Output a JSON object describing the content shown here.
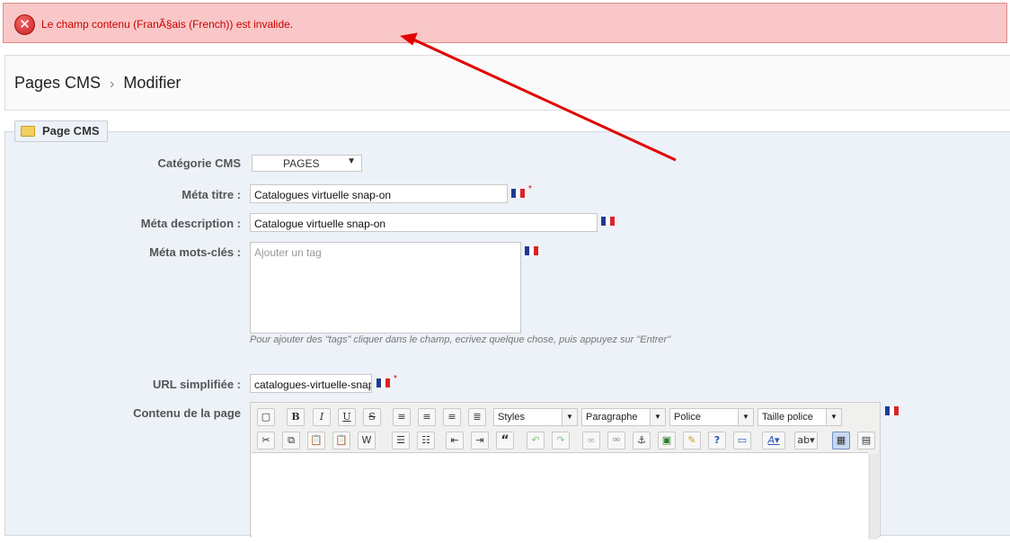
{
  "error": {
    "message": "Le champ contenu (FranÃ§ais (French)) est invalide."
  },
  "breadcrumb": {
    "parent": "Pages CMS",
    "current": "Modifier"
  },
  "panel": {
    "legend": "Page CMS"
  },
  "form": {
    "category": {
      "label": "Catégorie CMS",
      "value": "PAGES"
    },
    "meta_title": {
      "label": "Méta titre :",
      "value": "Catalogues virtuelle snap-on"
    },
    "meta_description": {
      "label": "Méta description :",
      "value": "Catalogue virtuelle snap-on"
    },
    "meta_keywords": {
      "label": "Méta mots-clés :",
      "placeholder": "Ajouter un tag",
      "help": "Pour ajouter des \"tags\" cliquer dans le champ, ecrivez quelque chose, puis appuyez sur \"Entrer\""
    },
    "friendly_url": {
      "label": "URL simplifiée :",
      "value": "catalogues-virtuelle-snap-on"
    },
    "content": {
      "label": "Contenu de la page"
    },
    "required_mark": "*"
  },
  "editor": {
    "dropdowns": [
      "Styles",
      "Paragraphe",
      "Police",
      "Taille police"
    ],
    "row1_icons": [
      "new-document-icon",
      "bold-icon",
      "italic-icon",
      "underline-icon",
      "strikethrough-icon",
      "align-left-icon",
      "align-center-icon",
      "align-right-icon",
      "align-justify-icon"
    ],
    "row2_icons": [
      "cut-icon",
      "copy-icon",
      "paste-icon",
      "paste-text-icon",
      "paste-word-icon",
      "bullet-list-icon",
      "numbered-list-icon",
      "outdent-icon",
      "indent-icon",
      "blockquote-icon",
      "undo-icon",
      "redo-icon",
      "link-icon",
      "unlink-icon",
      "anchor-icon",
      "image-icon",
      "cleanup-icon",
      "help-icon",
      "hr-icon",
      "text-color-icon",
      "background-color-icon",
      "media-icon",
      "table-icon"
    ]
  },
  "colors": {
    "error_bg": "#f9c7c7",
    "error_text": "#cc0000",
    "panel_bg": "#edf1f8",
    "arrow": "#e00000"
  }
}
